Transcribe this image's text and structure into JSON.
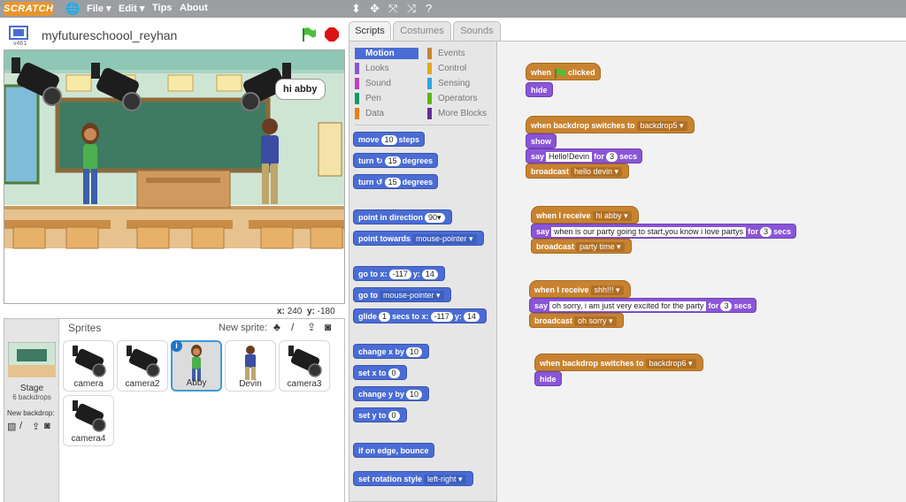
{
  "app": {
    "logo": "SCRATCH"
  },
  "menu": {
    "file": "File ▾",
    "edit": "Edit ▾",
    "tips": "Tips",
    "about": "About"
  },
  "stage_header": {
    "project_title": "myfutureschoool_reyhan",
    "version": "v461"
  },
  "stage_scene": {
    "speech_bubble": "hi abby"
  },
  "coords": {
    "x_label": "x:",
    "x_value": "240",
    "y_label": "y:",
    "y_value": "-180"
  },
  "sprites_panel": {
    "title": "Sprites",
    "new_sprite_label": "New sprite:",
    "stage": {
      "label": "Stage",
      "backdrops": "6 backdrops"
    },
    "new_backdrop_label": "New backdrop:",
    "items": [
      {
        "name": "camera",
        "kind": "camera"
      },
      {
        "name": "camera2",
        "kind": "camera"
      },
      {
        "name": "Abby",
        "kind": "girl",
        "selected": true
      },
      {
        "name": "Devin",
        "kind": "boy"
      },
      {
        "name": "camera3",
        "kind": "camera"
      },
      {
        "name": "camera4",
        "kind": "camera"
      }
    ]
  },
  "tabs": [
    "Scripts",
    "Costumes",
    "Sounds"
  ],
  "active_tab": "Scripts",
  "categories": [
    {
      "label": "Motion",
      "color": "#4a6cd4",
      "active": true
    },
    {
      "label": "Events",
      "color": "#c88330"
    },
    {
      "label": "Looks",
      "color": "#8a55d7"
    },
    {
      "label": "Control",
      "color": "#e1a91a"
    },
    {
      "label": "Sound",
      "color": "#bb42c3"
    },
    {
      "label": "Sensing",
      "color": "#2ca5e2"
    },
    {
      "label": "Pen",
      "color": "#0e9a6c"
    },
    {
      "label": "Operators",
      "color": "#5cb712"
    },
    {
      "label": "Data",
      "color": "#ee7d16"
    },
    {
      "label": "More Blocks",
      "color": "#632d99"
    }
  ],
  "palette": {
    "move": {
      "a": "move",
      "n": "10",
      "b": "steps"
    },
    "turn_cw": {
      "a": "turn",
      "n": "15",
      "b": "degrees"
    },
    "turn_ccw": {
      "a": "turn",
      "n": "15",
      "b": "degrees"
    },
    "point_dir": {
      "a": "point in direction",
      "n": "90▾"
    },
    "point_towards": {
      "a": "point towards",
      "d": "mouse-pointer ▾"
    },
    "go_xy": {
      "a": "go to x:",
      "x": "-117",
      "b": "y:",
      "y": "14"
    },
    "go_to": {
      "a": "go to",
      "d": "mouse-pointer ▾"
    },
    "glide": {
      "a": "glide",
      "s": "1",
      "b": "secs to x:",
      "x": "-117",
      "c": "y:",
      "y": "14"
    },
    "change_x": {
      "a": "change x by",
      "n": "10"
    },
    "set_x": {
      "a": "set x to",
      "n": "0"
    },
    "change_y": {
      "a": "change y by",
      "n": "10"
    },
    "set_y": {
      "a": "set y to",
      "n": "0"
    },
    "bounce": {
      "a": "if on edge, bounce"
    },
    "rotation": {
      "a": "set rotation style",
      "d": "left-right ▾"
    }
  },
  "scripts": {
    "s1_hat": {
      "a": "when",
      "b": "clicked"
    },
    "s1_hide": "hide",
    "s2_hat": {
      "a": "when backdrop switches to",
      "d": "backdrop5 ▾"
    },
    "s2_show": "show",
    "s2_say": {
      "a": "say",
      "t": "Hello!Devin",
      "b": "for",
      "n": "3",
      "c": "secs"
    },
    "s2_broadcast": {
      "a": "broadcast",
      "d": "hello devin ▾"
    },
    "s3_hat": {
      "a": "when I receive",
      "d": "hi abby ▾"
    },
    "s3_say": {
      "a": "say",
      "t": "when is our party going to start,you know i love partys",
      "b": "for",
      "n": "3",
      "c": "secs"
    },
    "s3_broadcast": {
      "a": "broadcast",
      "d": "party time ▾"
    },
    "s4_hat": {
      "a": "when I receive",
      "d": "shh!!! ▾"
    },
    "s4_say": {
      "a": "say",
      "t": "oh sorry, i am  just very excited for the party",
      "b": "for",
      "n": "3",
      "c": "secs"
    },
    "s4_broadcast": {
      "a": "broadcast",
      "d": "oh sorry ▾"
    },
    "s5_hat": {
      "a": "when backdrop switches to",
      "d": "backdrop6 ▾"
    },
    "s5_hide": "hide"
  }
}
